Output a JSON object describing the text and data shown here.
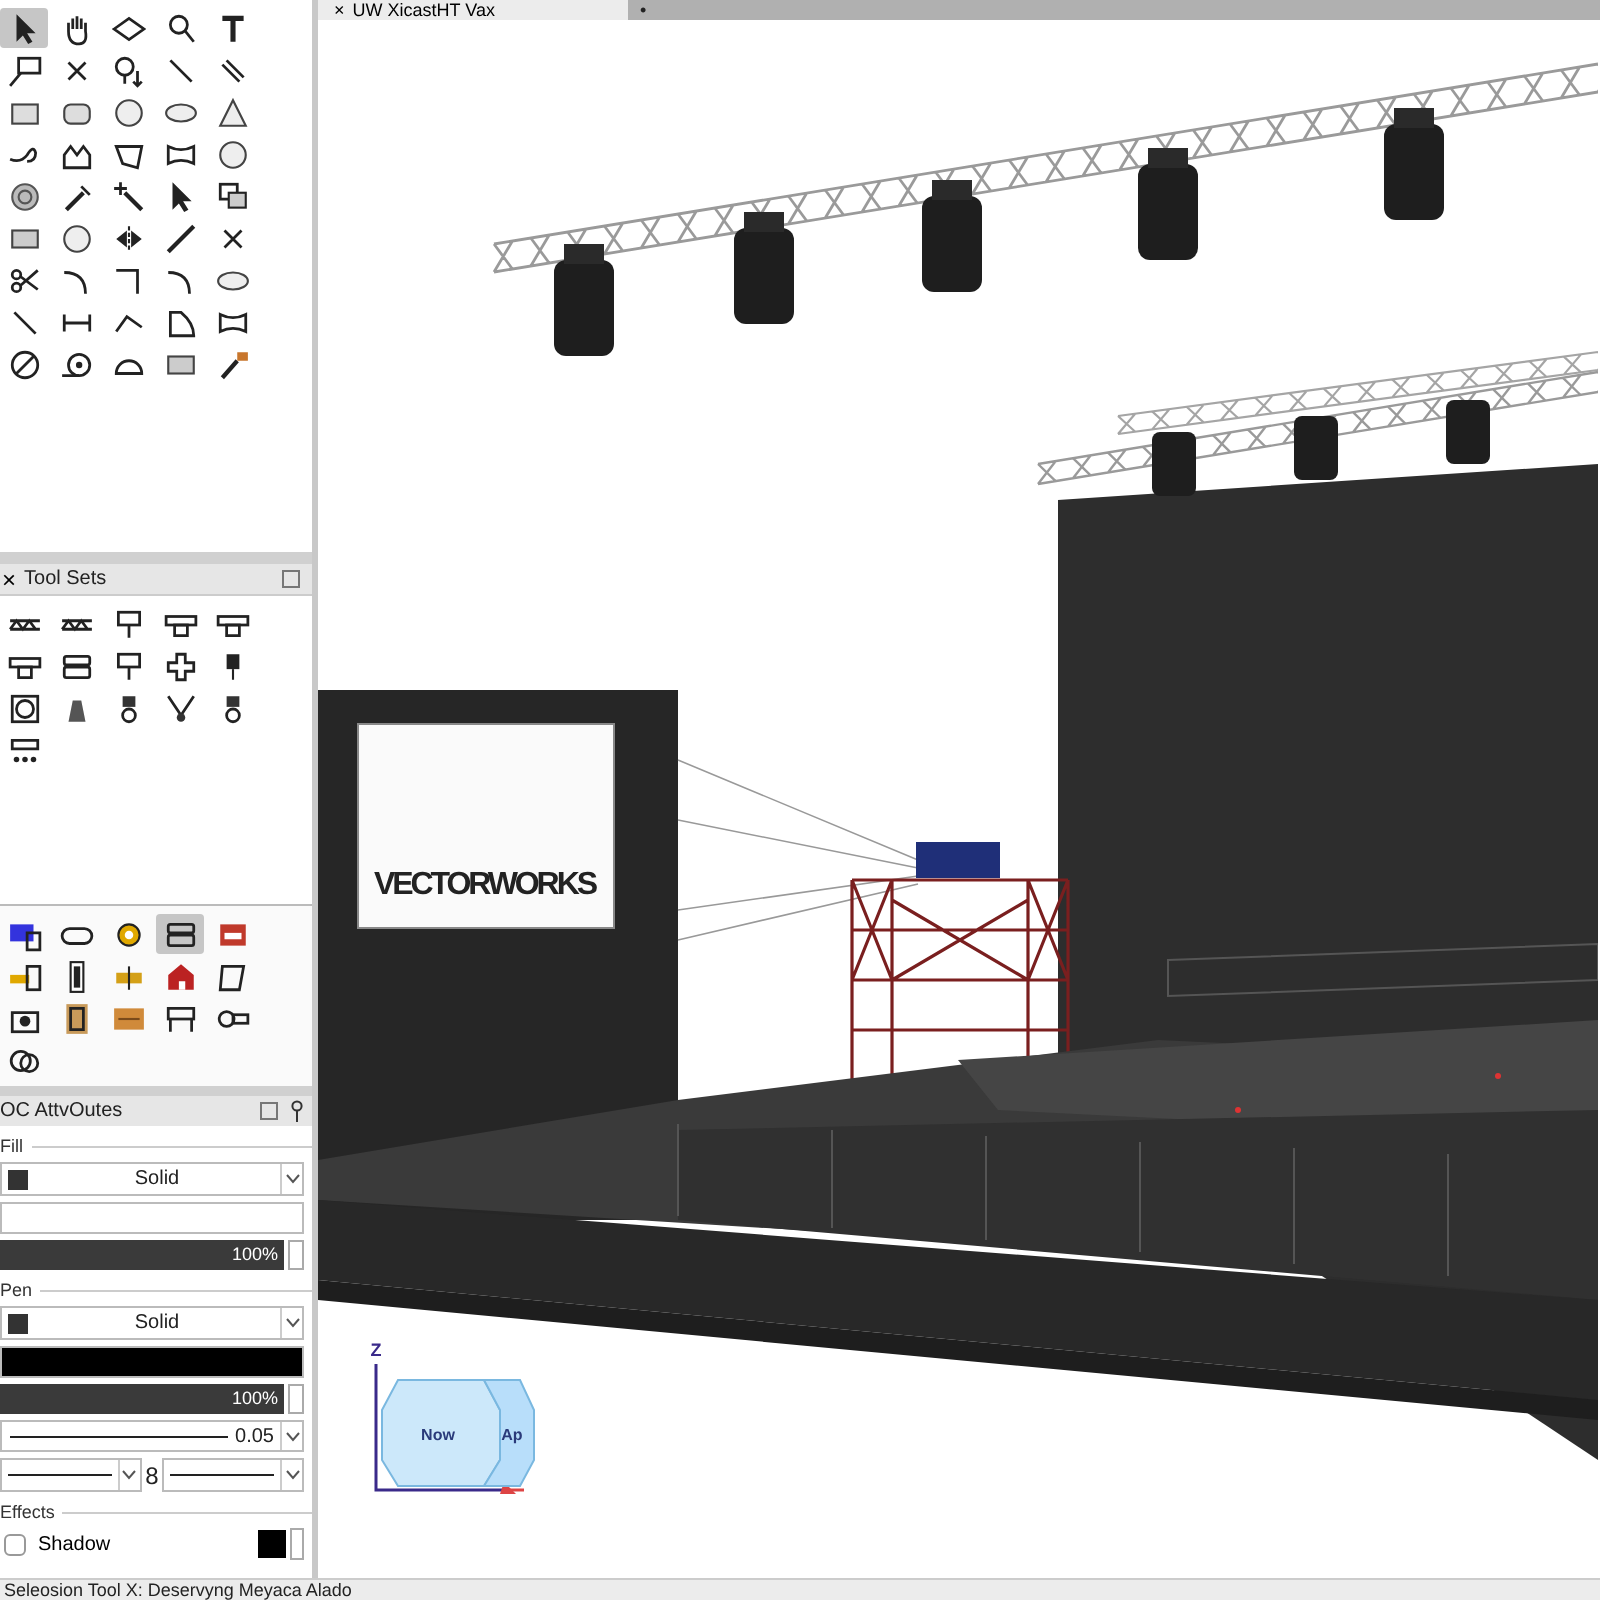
{
  "document_tab": {
    "close": "×",
    "title": "UW XicastHT Vax",
    "selected": true
  },
  "tab_strip_mark": "•",
  "basic_palette": {
    "tools": [
      {
        "selected": true
      },
      {
        "selected": false
      },
      {
        "selected": false
      },
      {
        "selected": false
      },
      {
        "selected": false
      },
      {
        "selected": false
      },
      {
        "selected": false
      },
      {
        "selected": false
      },
      {
        "selected": false
      },
      {
        "selected": false
      },
      {
        "selected": false
      },
      {
        "selected": false
      },
      {
        "selected": false
      },
      {
        "selected": false
      },
      {
        "selected": false
      },
      {
        "selected": false
      },
      {
        "selected": false
      },
      {
        "selected": false
      },
      {
        "selected": false
      },
      {
        "selected": false
      },
      {
        "selected": false
      },
      {
        "selected": false
      },
      {
        "selected": false
      },
      {
        "selected": false
      },
      {
        "selected": false
      },
      {
        "selected": false
      },
      {
        "selected": false
      },
      {
        "selected": false
      },
      {
        "selected": false
      },
      {
        "selected": false
      },
      {
        "selected": false
      },
      {
        "selected": false
      },
      {
        "selected": false
      },
      {
        "selected": false
      },
      {
        "selected": false
      },
      {
        "selected": false
      },
      {
        "selected": false
      },
      {
        "selected": false
      },
      {
        "selected": false
      },
      {
        "selected": false
      },
      {
        "selected": false
      },
      {
        "selected": false
      },
      {
        "selected": false
      },
      {
        "selected": false
      },
      {
        "selected": false
      }
    ]
  },
  "tool_sets": {
    "close": "×",
    "title": "Tool Sets",
    "tools": [
      {
        "selected": false
      },
      {
        "selected": false
      },
      {
        "selected": false
      },
      {
        "selected": false
      },
      {
        "selected": false
      },
      {
        "selected": false
      },
      {
        "selected": false
      },
      {
        "selected": false
      },
      {
        "selected": false
      },
      {
        "selected": false
      },
      {
        "selected": false
      },
      {
        "selected": false
      },
      {
        "selected": false
      },
      {
        "selected": false
      },
      {
        "selected": false
      },
      {
        "selected": false
      }
    ],
    "sets": [
      {
        "selected": false
      },
      {
        "selected": false
      },
      {
        "selected": false
      },
      {
        "selected": true
      },
      {
        "selected": false
      },
      {
        "selected": false
      },
      {
        "selected": false
      },
      {
        "selected": false
      },
      {
        "selected": false
      },
      {
        "selected": false
      },
      {
        "selected": false
      },
      {
        "selected": false
      },
      {
        "selected": false
      },
      {
        "selected": false
      },
      {
        "selected": false
      },
      {
        "selected": false
      }
    ]
  },
  "attributes": {
    "title": "OC AttvOutes",
    "fill": {
      "label": "Fill",
      "style": "Solid",
      "opacity": "100%",
      "level": 1
    },
    "pen": {
      "label": "Pen",
      "style": "Solid",
      "opacity": "100%",
      "level": 1,
      "thickness": "0.05",
      "link": "8"
    },
    "effects": {
      "label": "Effects",
      "shadow": {
        "label": "Shadow",
        "checked": false
      }
    }
  },
  "scene": {
    "logo": "VECTORWORKS"
  },
  "view_cube": {
    "axis": "Z",
    "front": "Now",
    "side": "Ap"
  },
  "status_bar": "Seleosion Tool  X: Deservyng Meyaca Alado"
}
